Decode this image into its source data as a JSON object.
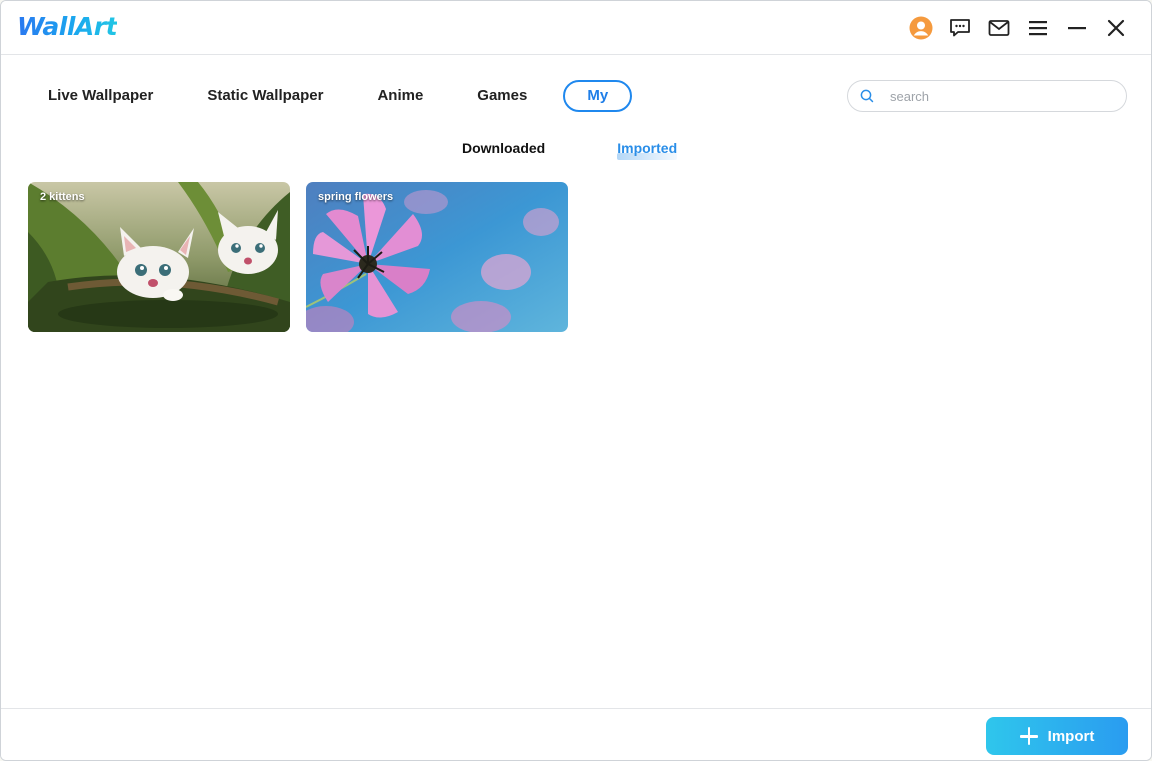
{
  "app": {
    "logo_text": "WallArt",
    "brand_color": "#1f88ee"
  },
  "titlebar": {
    "icons": [
      "user-avatar-icon",
      "message-icon",
      "mail-icon",
      "menu-icon",
      "minimize-icon",
      "close-icon"
    ]
  },
  "nav": {
    "tabs": [
      {
        "label": "Live Wallpaper",
        "active": false
      },
      {
        "label": "Static Wallpaper",
        "active": false
      },
      {
        "label": "Anime",
        "active": false
      },
      {
        "label": "Games",
        "active": false
      },
      {
        "label": "My",
        "active": true
      }
    ]
  },
  "search": {
    "placeholder": "search",
    "value": ""
  },
  "subtabs": [
    {
      "label": "Downloaded",
      "active": false
    },
    {
      "label": "Imported",
      "active": true
    }
  ],
  "wallpapers": [
    {
      "title": "2 kittens",
      "image": "kittens-in-leaves"
    },
    {
      "title": "spring flowers",
      "image": "pink-cosmos-flower"
    }
  ],
  "footer": {
    "import_label": "Import"
  }
}
